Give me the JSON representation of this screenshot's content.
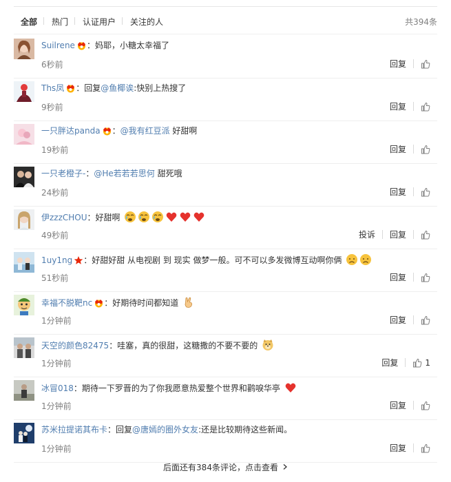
{
  "tabs": [
    {
      "label": "全部",
      "active": true
    },
    {
      "label": "热门",
      "active": false
    },
    {
      "label": "认证用户",
      "active": false
    },
    {
      "label": "关注的人",
      "active": false
    }
  ],
  "total": "共394条",
  "reply_label": "回复",
  "report_label": "投诉",
  "comments": [
    {
      "user": "Suilrene",
      "sep": "：",
      "text": "妈耶，小糖太幸福了",
      "time": "6秒前"
    },
    {
      "user": "Ths凤",
      "sep": "：",
      "prefix": "回复",
      "mention": "@鱼椰诶",
      "text": ":快别上热搜了",
      "time": "9秒前"
    },
    {
      "user": "一只胖达panda",
      "sep": "：",
      "mention": "@我有红豆派",
      "text": " 好甜啊",
      "time": "19秒前"
    },
    {
      "user": "一只老橙子-",
      "sep": "：",
      "mention": "@He若若若思何",
      "text": " 甜死哦",
      "time": "24秒前"
    },
    {
      "user": "伊zzzCHOU",
      "sep": "：",
      "text": "好甜啊",
      "time": "49秒前"
    },
    {
      "user": "1uy1ng",
      "sep": "：",
      "text": "好甜好甜 从电视剧 到 现实 做梦一般。可不可以多发微博互动啊你俩",
      "time": "51秒前"
    },
    {
      "user": "幸福不脱靶nc",
      "sep": "：",
      "text": "好期待时间都知道",
      "time": "1分钟前"
    },
    {
      "user": "天空的颜色82475",
      "sep": "：",
      "text": "哇塞，真的很甜，这糖撒的不要不要的",
      "time": "1分钟前",
      "likes": "1"
    },
    {
      "user": "冰冒018",
      "sep": "：",
      "text": "期待一下罗晋的为了你我愿意热爱整个世界和鹳唳华亭",
      "time": "1分钟前"
    },
    {
      "user": "苏米拉提诺其布卡",
      "sep": "：",
      "prefix": "回复",
      "mention": "@唐嫣的圈外女友",
      "text": ":还是比较期待这些新闻。",
      "time": "1分钟前"
    }
  ],
  "more_label": "后面还有384条评论，点击查看",
  "colors": {
    "link": "#507daf",
    "muted": "#808080",
    "heart": "#e5322d",
    "emoji": "#f7c33d"
  }
}
